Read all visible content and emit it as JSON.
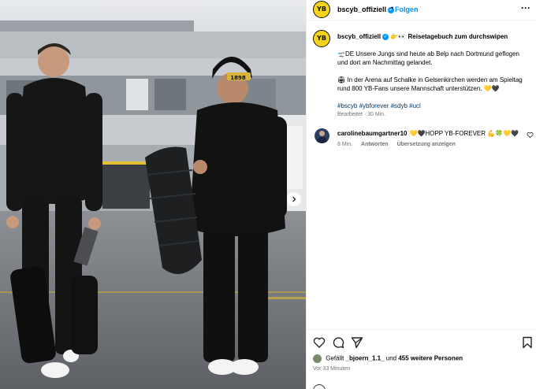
{
  "header": {
    "username": "bscyb_offiziell",
    "separator": "•",
    "follow_label": "Folgen",
    "more_label": "···"
  },
  "avatar": {
    "initials": "YB",
    "color": "#f5d31b"
  },
  "caption": {
    "username": "bscyb_offiziell",
    "title": "👉👀 Reisetagebuch zum durchswipen",
    "line1": "🛫DE Unsere Jungs sind heute ab Belp nach Dortmund geflogen und dort am Nachmittag gelandet.",
    "line2": "🏟 In der Arena auf Schalke in Gelsenkirchen werden am Spieltag rund 800 YB-Fans unsere Mannschaft unterstützen. 💛🖤",
    "hashtags": "#bscyb #ybforever #sdyb #ucl",
    "edited": "Bearbeitet · 30 Min."
  },
  "comment": {
    "username": "carolinebaumgartner10",
    "text": "💛🖤HOPP YB-FOREVER 💪🍀💛🖤",
    "time": "8 Min.",
    "reply_label": "Antworten",
    "translate_label": "Übersetzung anzeigen"
  },
  "likes": {
    "prefix": "Gefällt",
    "user": "_bjoern_1.1_",
    "middle": "und",
    "others": "455 weitere Personen"
  },
  "posted_ago": "Vor 33 Minuten",
  "photo": {
    "cap_text": "1898"
  },
  "colors": {
    "link_blue": "#0095f6",
    "hashtag_blue": "#00376b",
    "yb_yellow": "#f5d31b",
    "muted": "#737373"
  }
}
